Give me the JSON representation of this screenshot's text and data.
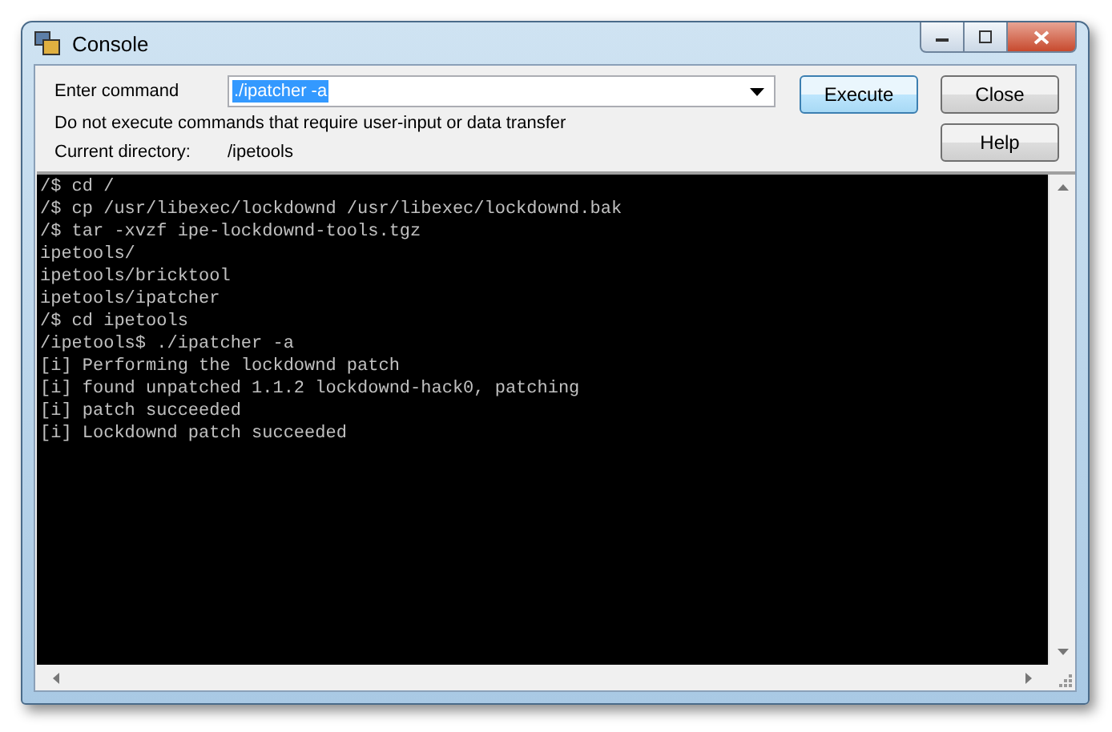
{
  "window": {
    "title": "Console"
  },
  "command": {
    "label": "Enter command",
    "value": "./ipatcher -a",
    "selected": true
  },
  "warning": "Do not execute commands that require user-input or data transfer",
  "directory": {
    "label": "Current directory:",
    "value": "/ipetools"
  },
  "buttons": [
    {
      "label": "Execute",
      "default": true
    },
    {
      "label": "Close",
      "default": false
    },
    {
      "label": "Help",
      "default": false
    }
  ],
  "output": [
    "/$ cd /",
    "/$ cp /usr/libexec/lockdownd /usr/libexec/lockdownd.bak",
    "/$ tar -xvzf ipe-lockdownd-tools.tgz",
    "ipetools/",
    "ipetools/bricktool",
    "ipetools/ipatcher",
    "/$ cd ipetools",
    "/ipetools$ ./ipatcher -a",
    "[i] Performing the lockdownd patch",
    "[i] found unpatched 1.1.2 lockdownd-hack0, patching",
    "[i] patch succeeded",
    "[i] Lockdownd patch succeeded"
  ]
}
